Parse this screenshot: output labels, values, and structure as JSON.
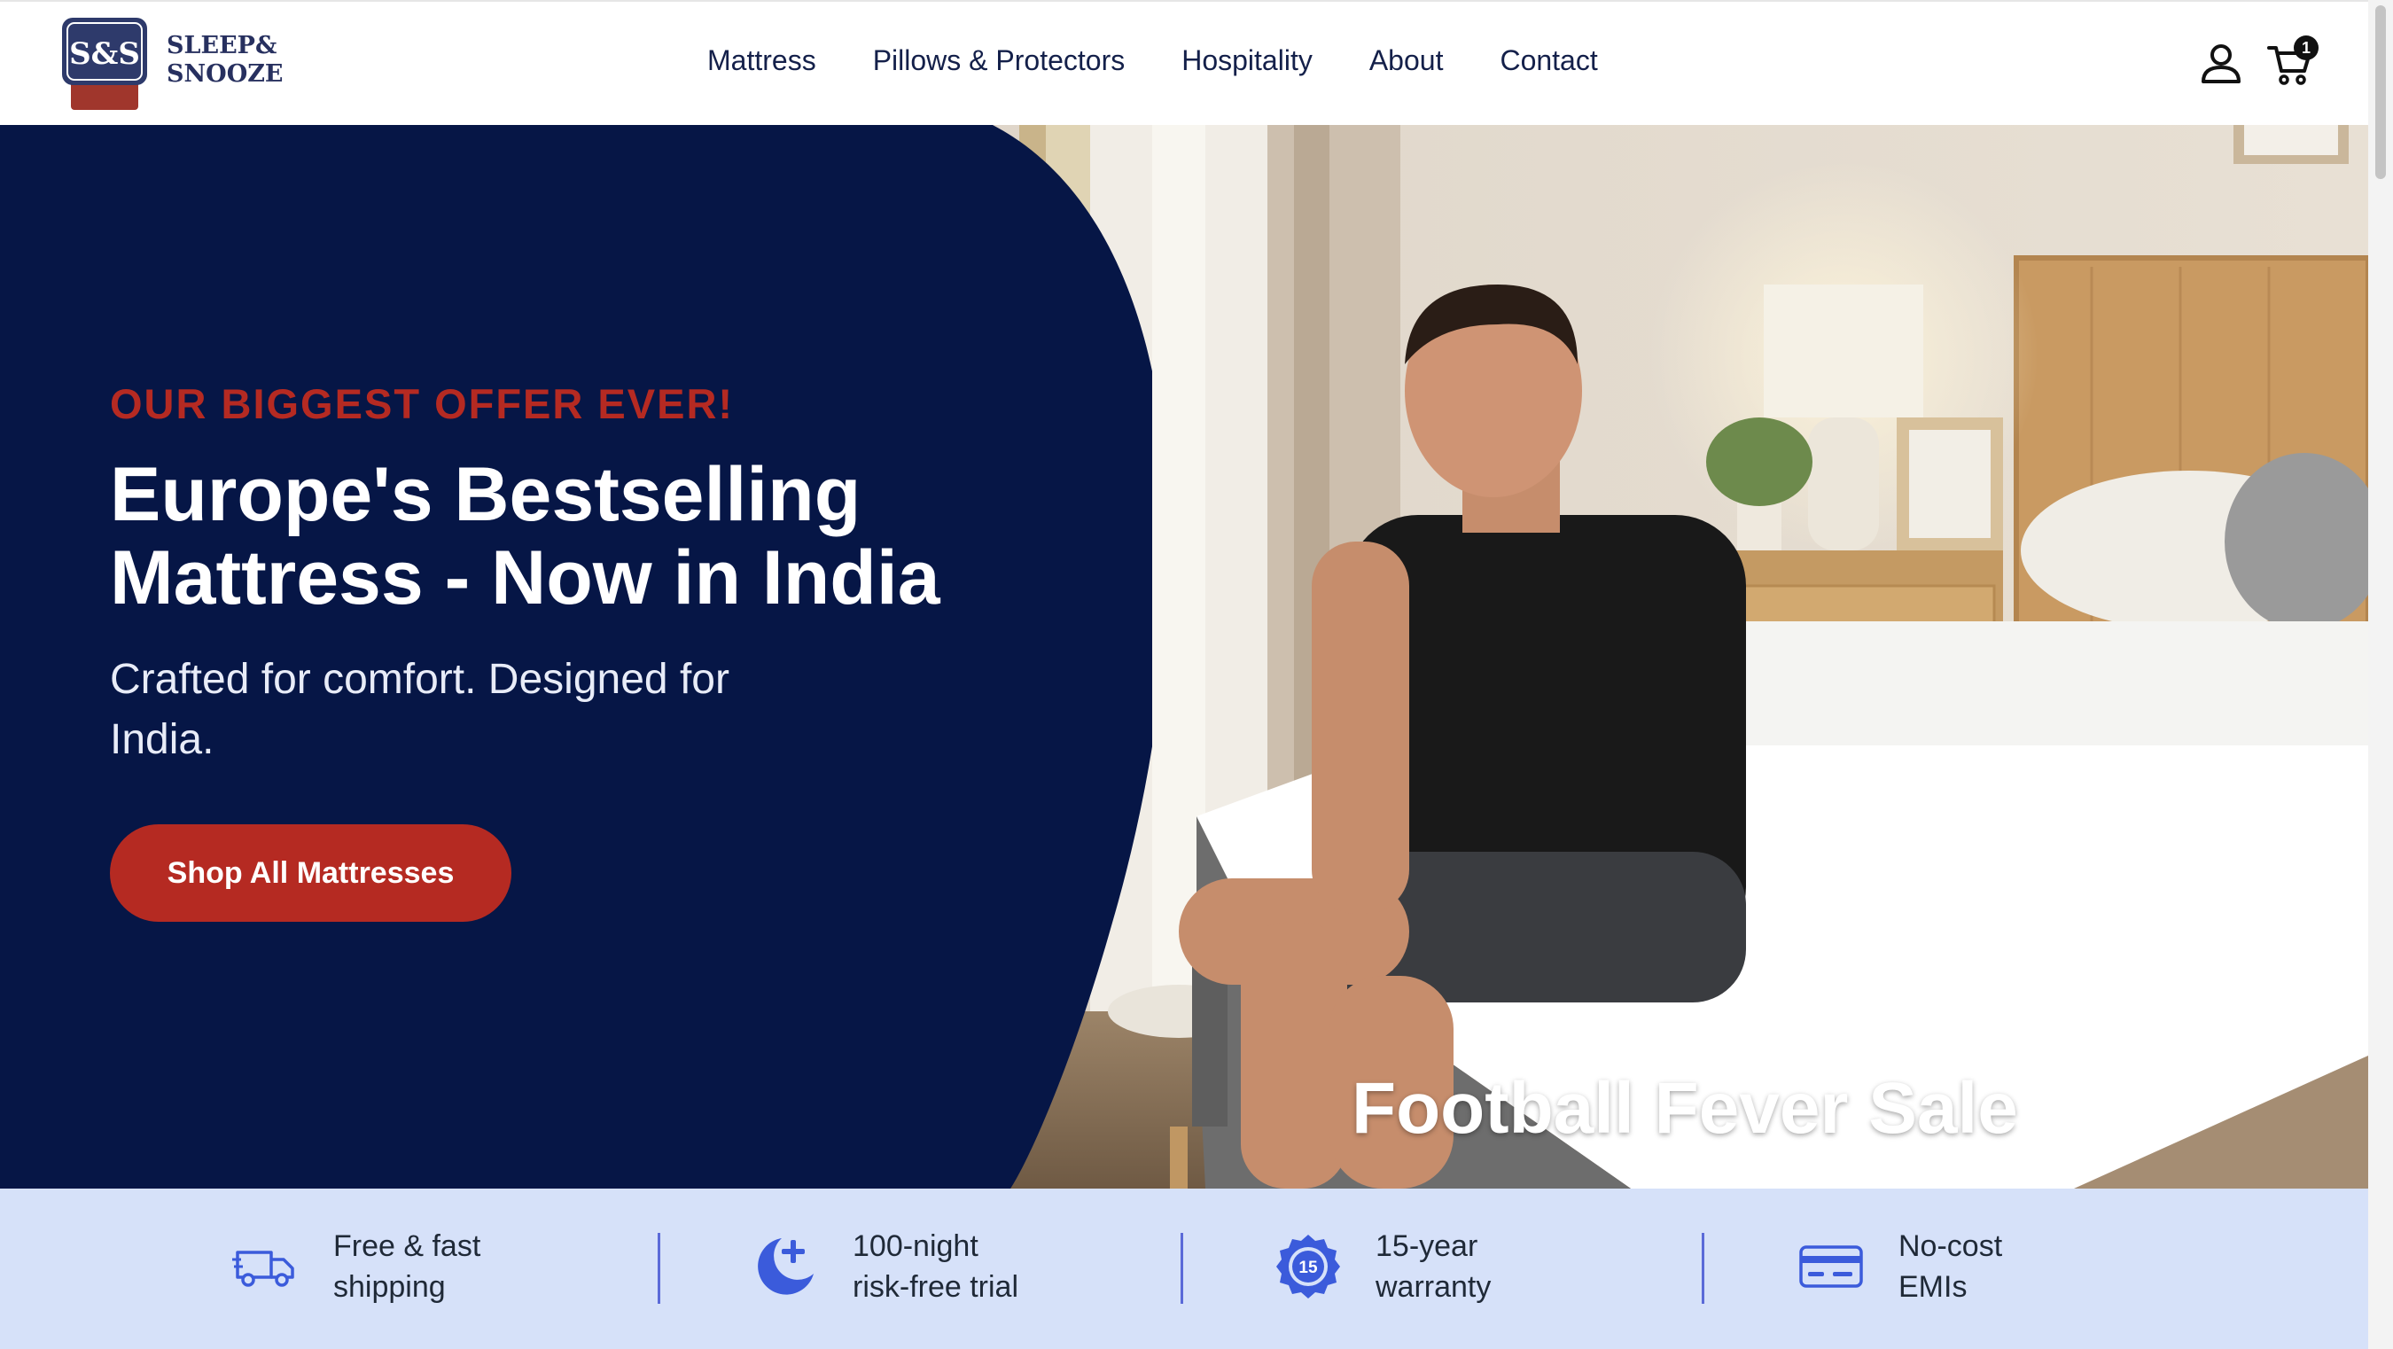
{
  "brand": {
    "line1": "SLEEP&",
    "line2": "SNOOZE",
    "badge_text": "S&S",
    "primary_color": "#27305f",
    "accent_color": "#b52a22"
  },
  "nav": {
    "items": [
      {
        "label": "Mattress"
      },
      {
        "label": "Pillows & Protectors"
      },
      {
        "label": "Hospitality"
      },
      {
        "label": "About"
      },
      {
        "label": "Contact"
      }
    ]
  },
  "header": {
    "account_icon": "user-icon",
    "cart_icon": "cart-icon",
    "cart_count": "1"
  },
  "hero": {
    "eyebrow": "OUR BIGGEST OFFER EVER!",
    "title_line1": "Europe's Bestselling",
    "title_line2": "Mattress - Now in India",
    "subtitle": "Crafted for comfort. Designed for India.",
    "cta_label": "Shop All Mattresses",
    "sale_text": "Football Fever Sale",
    "panel_color": "#061646"
  },
  "features": [
    {
      "icon": "truck-icon",
      "line1": "Free & fast",
      "line2": "shipping"
    },
    {
      "icon": "moon-plus-icon",
      "line1": "100-night",
      "line2": "risk-free trial"
    },
    {
      "icon": "warranty-badge-icon",
      "line1": "15-year",
      "line2": "warranty",
      "badge_number": "15"
    },
    {
      "icon": "credit-card-icon",
      "line1": "No-cost",
      "line2": "EMIs"
    }
  ]
}
